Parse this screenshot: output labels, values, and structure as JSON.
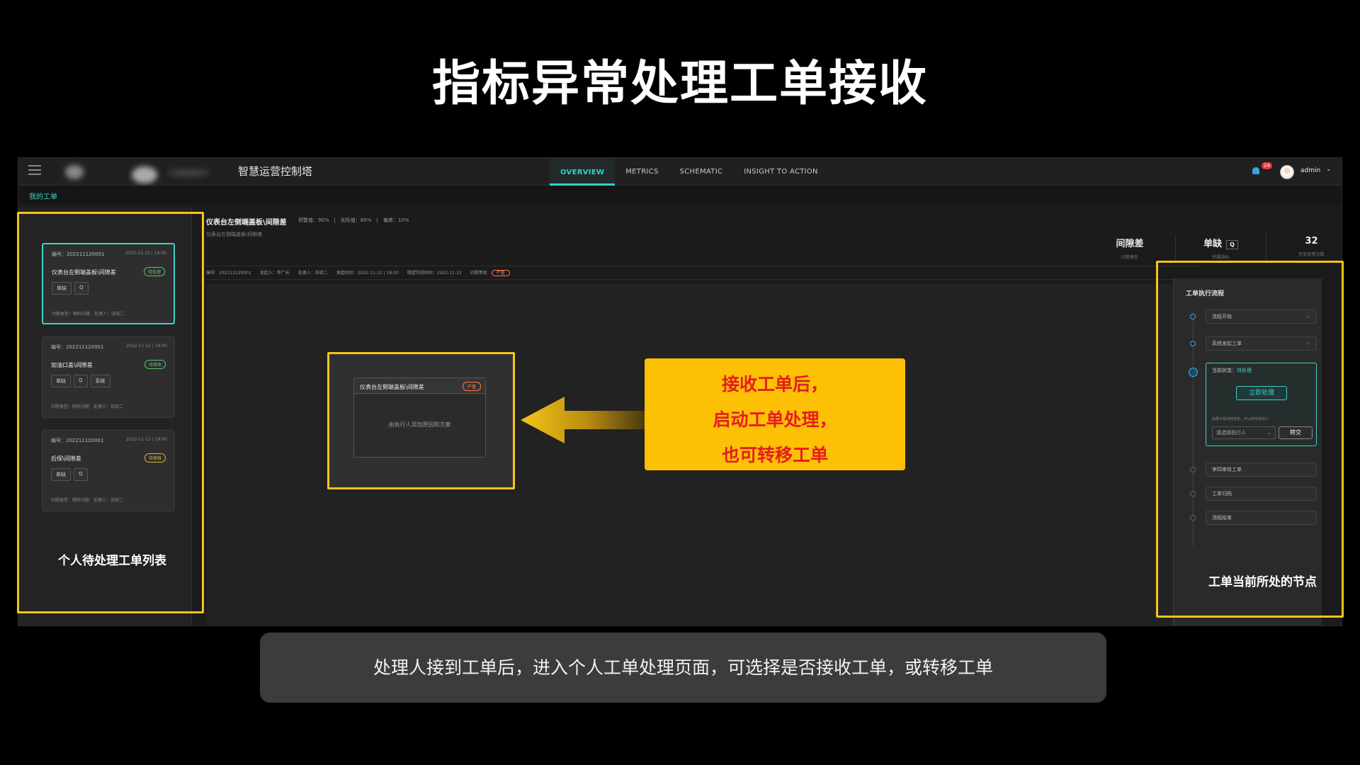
{
  "slide": {
    "title": "指标异常处理工单接收",
    "caption": "处理人接到工单后，进入个人工单处理页面，可选择是否接收工单，或转移工单"
  },
  "app": {
    "name": "智慧运营控制塔",
    "nav": [
      "OVERVIEW",
      "METRICS",
      "SCHEMATIC",
      "INSIGHT TO ACTION"
    ],
    "active_tab": "OVERVIEW",
    "notification_count": "24",
    "user": "admin",
    "breadcrumb": "我的工单",
    "accent_color": "#2fd4cc"
  },
  "tickets": [
    {
      "no": "编号：202211120001",
      "time": "2022-11-12 | 19:00",
      "name": "仪表台左侧端盖板\\间隙差",
      "status": "待处理",
      "tags": [
        "单缺",
        "Q"
      ],
      "meta": "问题类型：物料问题　处理人：张晓二"
    },
    {
      "no": "编号：202211120001",
      "time": "2022-11-12 | 19:00",
      "name": "加油口盖\\间隙差",
      "status": "待接收",
      "tags": [
        "单缺",
        "Q",
        "系统"
      ],
      "meta": "问题类型：物料问题　处理人：张晓二"
    },
    {
      "no": "编号：202211120001",
      "time": "2022-11-12 | 19:00",
      "name": "后保\\间隙差",
      "status": "待审核",
      "tags": [
        "单缺",
        "Q"
      ],
      "meta": "问题类型：物料问题　处理人：张晓二"
    }
  ],
  "detail": {
    "title": "仪表台左侧端盖板\\间隙差",
    "kpis": "预警值：90%　|　实际值：80%　|　偏差：10%",
    "subtitle": "仪表台左侧端盖板\\间隙差",
    "info": "编号：202211120001　　发起人：李广长　　处理人：张晓二　　发起时间：2022-11-12 | 19:00　　期望完成时间：2022-11-13　　问题等级",
    "severity": "严重",
    "stats": [
      {
        "value": "间隙差",
        "label": "问题类型"
      },
      {
        "value": "单缺",
        "q": "Q",
        "label": "所属指标"
      },
      {
        "value": "32",
        "label": "历史异常次数"
      }
    ]
  },
  "flow": {
    "title": "工单执行流程",
    "steps_done": [
      "流程开始",
      "系统发起工单"
    ],
    "current_label": "当前状态：",
    "current_status": "待处理",
    "process_button": "立即处理",
    "hint": "如果不是你的任务，可以转交给他人",
    "assignee_placeholder": "请选择执行人",
    "transfer_button": "转交",
    "steps_pending": [
      "李四审核工单",
      "工单归档",
      "流程结束"
    ]
  },
  "popup": {
    "title": "仪表台左侧端盖板\\间隙差",
    "badge": "严重",
    "body": "由执行人添加原因和方案"
  },
  "annotations": {
    "callout": [
      "接收工单后，",
      "启动工单处理，",
      "也可转移工单"
    ],
    "left_label": "个人待处理工单列表",
    "right_label": "工单当前所处的节点",
    "highlight_color": "#f5c518"
  }
}
